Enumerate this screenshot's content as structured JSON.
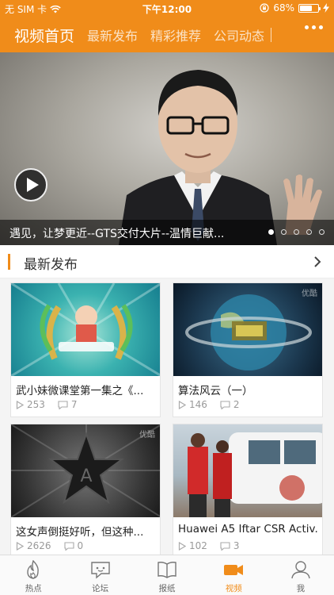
{
  "status_bar": {
    "carrier": "无 SIM 卡",
    "time": "下午12:00",
    "battery_percent_text": "68%",
    "battery_level": 0.68,
    "icons": [
      "wifi-icon",
      "rotation-lock-icon",
      "battery-icon",
      "charging-icon"
    ]
  },
  "nav": {
    "tabs": [
      {
        "label": "视频首页",
        "active": true
      },
      {
        "label": "最新发布",
        "active": false
      },
      {
        "label": "精彩推荐",
        "active": false
      },
      {
        "label": "公司动态",
        "active": false
      }
    ],
    "more_icon": "more-dots-icon"
  },
  "hero": {
    "caption": "遇见，让梦更近--GTS交付大片--温情巨献...",
    "slide_count": 5,
    "active_slide": 1,
    "play_icon": "play-icon"
  },
  "section": {
    "title": "最新发布",
    "arrow_icon": "chevron-right-icon"
  },
  "videos": [
    {
      "title": "武小妹微课堂第一集之《...",
      "plays": "253",
      "comments": "7"
    },
    {
      "title": "算法风云（一）",
      "plays": "146",
      "comments": "2"
    },
    {
      "title": "这女声倒挺好听，但这种...",
      "plays": "2626",
      "comments": "0"
    },
    {
      "title": "Huawei A5 Iftar CSR Activ...",
      "plays": "102",
      "comments": "3"
    }
  ],
  "watermark_text": "优酷",
  "tabbar": {
    "items": [
      {
        "label": "热点",
        "icon": "flame-icon",
        "active": false
      },
      {
        "label": "论坛",
        "icon": "chat-bubble-icon",
        "active": false
      },
      {
        "label": "报纸",
        "icon": "book-icon",
        "active": false
      },
      {
        "label": "视频",
        "icon": "video-camera-icon",
        "active": true
      },
      {
        "label": "我",
        "icon": "person-icon",
        "active": false
      }
    ]
  },
  "colors": {
    "accent": "#f08c1a",
    "tab_inactive": "#666666",
    "meta_gray": "#999999"
  }
}
